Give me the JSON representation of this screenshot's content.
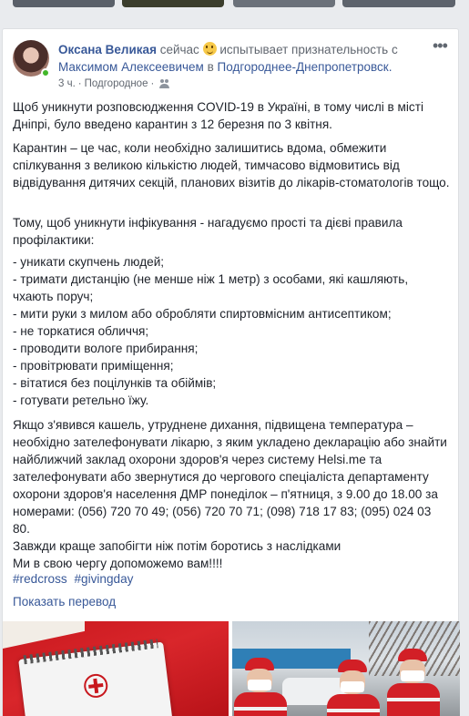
{
  "post": {
    "author": "Оксана Великая",
    "time_inline": "сейчас",
    "feeling": "испытывает признательность с",
    "tagged": "Максимом Алексеевичем",
    "location_prefix": "в",
    "location": "Подгороднее-Днепропетровск.",
    "timestamp": "3 ч.",
    "place": "Подгородное",
    "separator": "·",
    "paragraphs": [
      "Щоб уникнути розповсюдження COVID-19 в Україні, в тому числі в місті Дніпрі, було введено карантин з 12 березня по 3 квітня.",
      "Карантин – це час, коли необхідно залишитись вдома, обмежити спілкування з великою кількістю людей, тимчасово відмовитись від відвідування дитячих секцій, планових візитів до лікарів-стоматологів тощо.",
      "Тому, щоб уникнути інфікування - нагадуємо прості та дієві правила профілактики:"
    ],
    "rules": [
      "- уникати скупчень людей;",
      "- тримати дистанцію (не менше ніж 1 метр) з особами, які кашляють, чхають поруч;",
      "- мити руки з милом або обробляти спиртовмісним антисептиком;",
      "- не торкатися обличчя;",
      "- проводити вологе прибирання;",
      "- провітрювати приміщення;",
      "- вітатися без поцілунків та обіймів;",
      "- готувати ретельно їжу."
    ],
    "closing": [
      "Якщо з'явився кашель, утруднене дихання, підвищена температура – необхідно зателефонувати лікарю, з яким укладено декларацію або знайти найближчий заклад охорони здоров'я через систему Helsi.me та зателефонувати або звернутися до чергового спеціаліста департаменту охорони здоров'я населення ДМР понеділок – п'ятниця, з 9.00 до 18.00 за номерами: (056) 720 70 49; (056) 720 70 71; (098) 718 17 83; (095) 024 03 80.",
      "Завжди краще запобігти ніж потім боротись з наслідками",
      "Ми в свою чергу допоможемо вам!!!!"
    ],
    "hashtags": [
      "#redcross",
      "#givingday"
    ],
    "translate": "Показать перевод"
  },
  "colors": {
    "link": "#385898",
    "online": "#42b72a",
    "red_cross": "#d21f26"
  }
}
